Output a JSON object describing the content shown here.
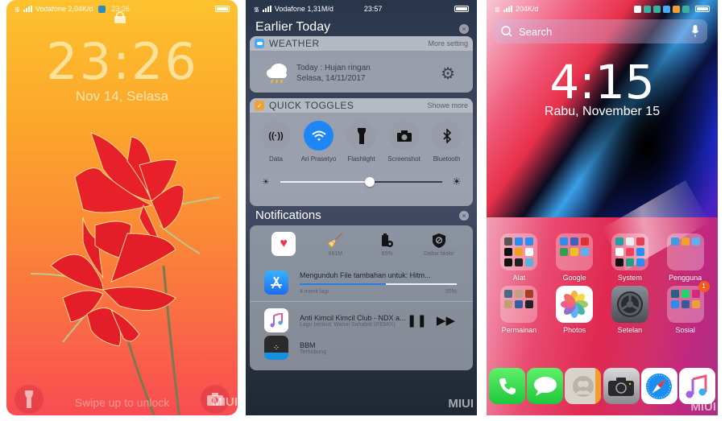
{
  "lockscreen": {
    "status": {
      "carrier": "Vodafone 2,04K/d",
      "time": "23:26"
    },
    "clock": "23:26",
    "date": "Nov 14, Selasa",
    "swipe_hint": "Swipe up to unlock",
    "watermark": "MIUI",
    "icons": {
      "flashlight": "flashlight-icon",
      "camera": "camera-icon",
      "lock": "lock-icon"
    }
  },
  "notification_center": {
    "status": {
      "carrier": "Vodafone 1,31M/d",
      "time": "23:57"
    },
    "section_earlier": "Earlier Today",
    "weather": {
      "title": "WEATHER",
      "more": "More setting",
      "line1": "Today : Hujan ringan",
      "line2": "Selasa, 14/11/2017"
    },
    "quick_toggles": {
      "title": "QUICK TOGGLES",
      "more": "Showe more",
      "items": [
        {
          "label": "Data",
          "glyph": "((·))",
          "on": false
        },
        {
          "label": "Ari Prasetyo",
          "glyph": "wifi",
          "on": true
        },
        {
          "label": "Flashlight",
          "glyph": "▮",
          "on": false
        },
        {
          "label": "Screenshot",
          "glyph": "◙",
          "on": false
        },
        {
          "label": "Bluetooth",
          "glyph": "ᛒ",
          "on": false
        }
      ],
      "brightness": 0.55
    },
    "section_notifications": "Notifications",
    "utilities": [
      {
        "label": "",
        "name": "health-icon"
      },
      {
        "label": "681M",
        "name": "cleaner-icon"
      },
      {
        "label": "85%",
        "name": "battery-settings-icon"
      },
      {
        "label": "Daftar blokir",
        "name": "blocklist-shield-icon"
      }
    ],
    "download": {
      "title": "Mengunduh File tambahan untuk: Hitm...",
      "eta": "4 menit lagi",
      "percent_label": "55%",
      "progress": 0.55
    },
    "music": {
      "title": "Anti Kimcil Kimcil Club - NDX a...",
      "subtitle": "Lagu berikut: Wahai Sahabat (REMIX)"
    },
    "bbm": {
      "title": "BBM",
      "subtitle": "Terhubung"
    },
    "watermark": "MIUI"
  },
  "homescreen": {
    "status": {
      "speed": "204K/d"
    },
    "search_placeholder": "Search",
    "clock": "4:15",
    "date": "Rabu, November 15",
    "row1": [
      {
        "label": "Alat",
        "type": "folder"
      },
      {
        "label": "Google",
        "type": "folder"
      },
      {
        "label": "System",
        "type": "folder"
      },
      {
        "label": "Pengguna",
        "type": "folder"
      }
    ],
    "row2": [
      {
        "label": "Permainan",
        "type": "folder"
      },
      {
        "label": "Photos",
        "type": "app"
      },
      {
        "label": "Setelan",
        "type": "app"
      },
      {
        "label": "Sosial",
        "type": "folder",
        "badge": "1"
      }
    ],
    "dock": [
      "Phone",
      "Messages",
      "Contacts",
      "Camera",
      "Safari",
      "Music"
    ],
    "watermark": "MIUI"
  }
}
